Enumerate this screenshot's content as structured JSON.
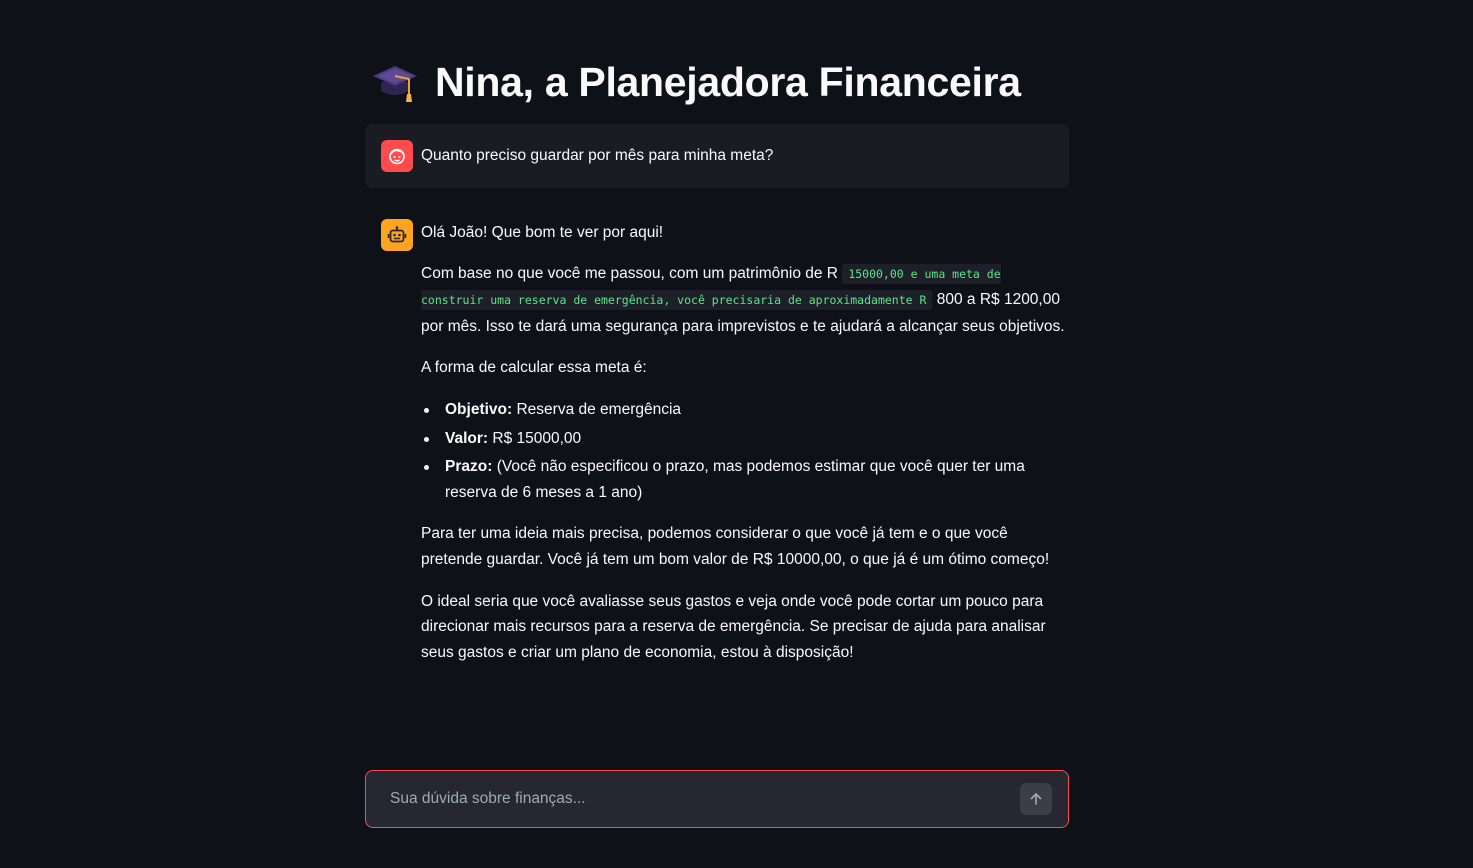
{
  "header": {
    "title_icon": "graduation-cap-icon",
    "title": "Nina, a Planejadora Financeira"
  },
  "chat": {
    "messages": [
      {
        "role": "user",
        "avatar_icon": "user-face-icon",
        "avatar_color": "#ff4b4b",
        "text": "Quanto preciso guardar por mês para minha meta?"
      },
      {
        "role": "assistant",
        "avatar_icon": "robot-icon",
        "avatar_color": "#ffa421",
        "greeting": "Olá João! Que bom te ver por aqui!",
        "p1_before": "Com base no que você me passou, com um patrimônio de R",
        "p1_code": "15000,00 e uma meta de construir uma reserva de emergência, você precisaria de aproximadamente R",
        "p1_after": "800 a R$ 1200,00 por mês. Isso te dará uma segurança para imprevistos e te ajudará a alcançar seus objetivos.",
        "p2": "A forma de calcular essa meta é:",
        "list": [
          {
            "label": "Objetivo:",
            "value": "Reserva de emergência"
          },
          {
            "label": "Valor:",
            "value": "R$ 15000,00"
          },
          {
            "label": "Prazo:",
            "value": "(Você não especificou o prazo, mas podemos estimar que você quer ter uma reserva de 6 meses a 1 ano)"
          }
        ],
        "p3": "Para ter uma ideia mais precisa, podemos considerar o que você já tem e o que você pretende guardar. Você já tem um bom valor de R$ 10000,00, o que já é um ótimo começo!",
        "p4": "O ideal seria que você avaliasse seus gastos e veja onde você pode cortar um pouco para direcionar mais recursos para a reserva de emergência. Se precisar de ajuda para analisar seus gastos e criar um plano de economia, estou à disposição!"
      }
    ]
  },
  "input": {
    "placeholder": "Sua dúvida sobre finanças...",
    "value": "",
    "send_icon": "arrow-up-icon"
  },
  "colors": {
    "background": "#0e1117",
    "accent": "#ff4b4b",
    "code_text": "#5ce488"
  }
}
